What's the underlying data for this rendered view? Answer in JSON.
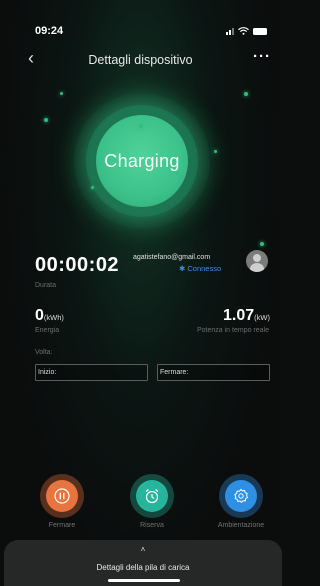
{
  "status_bar": {
    "time": "09:24"
  },
  "header": {
    "title": "Dettagli dispositivo"
  },
  "charging": {
    "status": "Charging"
  },
  "session": {
    "elapsed": "00:00:02",
    "elapsed_label": "Durata",
    "user_email": "agatistefano@gmail.com",
    "connection": "✱ Connesso"
  },
  "metrics": {
    "energy_value": "0",
    "energy_unit": "(kWh)",
    "energy_label": "Energia",
    "power_value": "1.07",
    "power_unit": "(kW)",
    "power_label": "Potenza in tempo reale"
  },
  "schedule": {
    "label": "Volta:",
    "start_placeholder": "Inizio:",
    "stop_placeholder": "Fermare:"
  },
  "actions": [
    {
      "label": "Fermare",
      "icon": "pause-icon",
      "color": "#e8743f"
    },
    {
      "label": "Riserva",
      "icon": "alarm-clock-icon",
      "color": "#26b59a"
    },
    {
      "label": "Ambientazione",
      "icon": "gear-icon",
      "color": "#2f8fe3"
    }
  ],
  "bottom_sheet": {
    "label": "Dettagli della pila di carica"
  },
  "colors": {
    "accent_green": "#3cc18a",
    "link_blue": "#3a8fe8"
  }
}
